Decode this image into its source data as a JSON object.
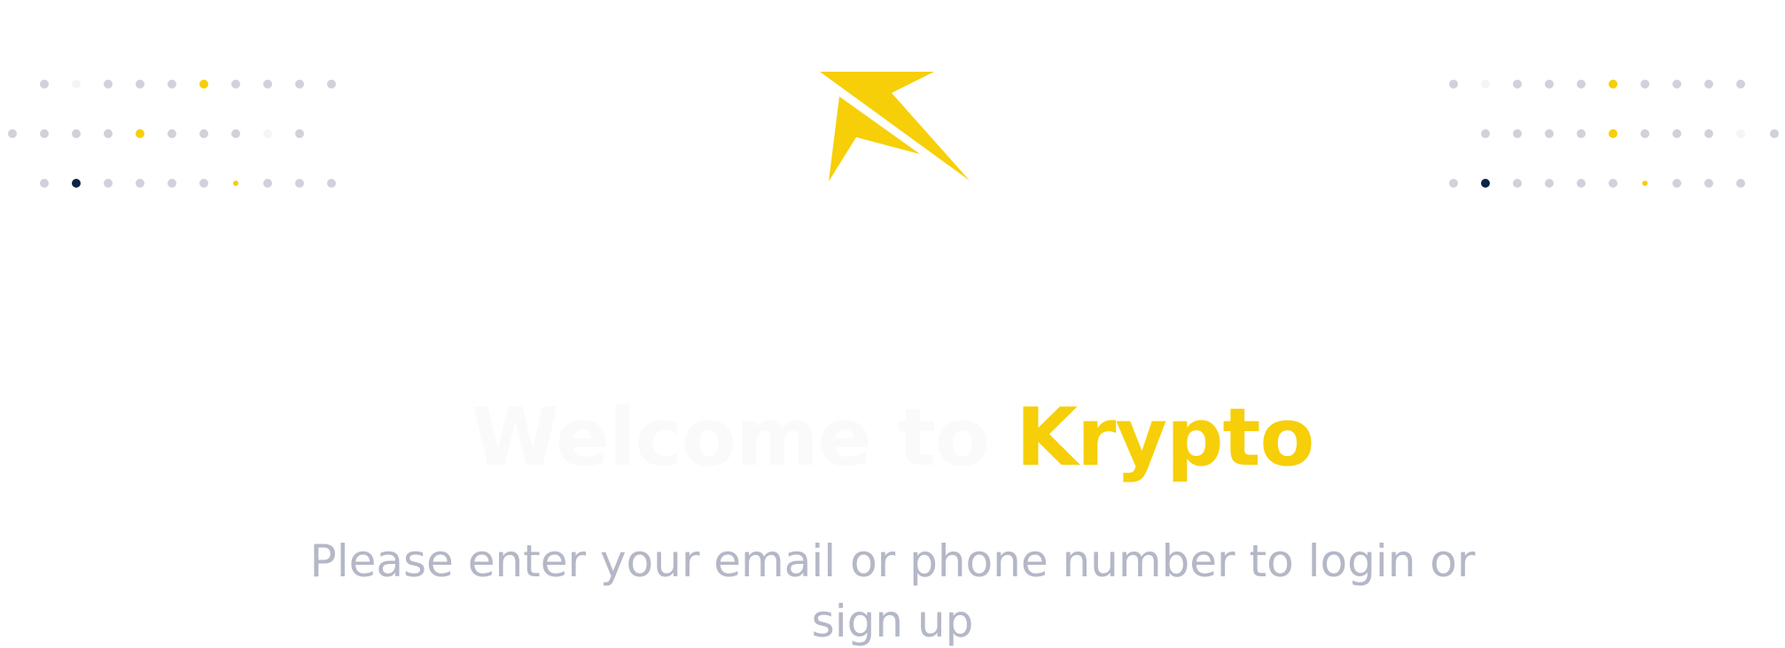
{
  "welcome": {
    "lead": "Welcome to",
    "brand": "Krypto",
    "subtitle": "Please enter your email or phone number to login or sign up"
  },
  "icons": {
    "logo": "krypto-arrow-logo"
  },
  "colors": {
    "brand_yellow": "#f6cf08",
    "dot_grey": "#cfd2d9",
    "dot_navy": "#0b2447",
    "subtitle_grey": "#b4b7c6"
  }
}
